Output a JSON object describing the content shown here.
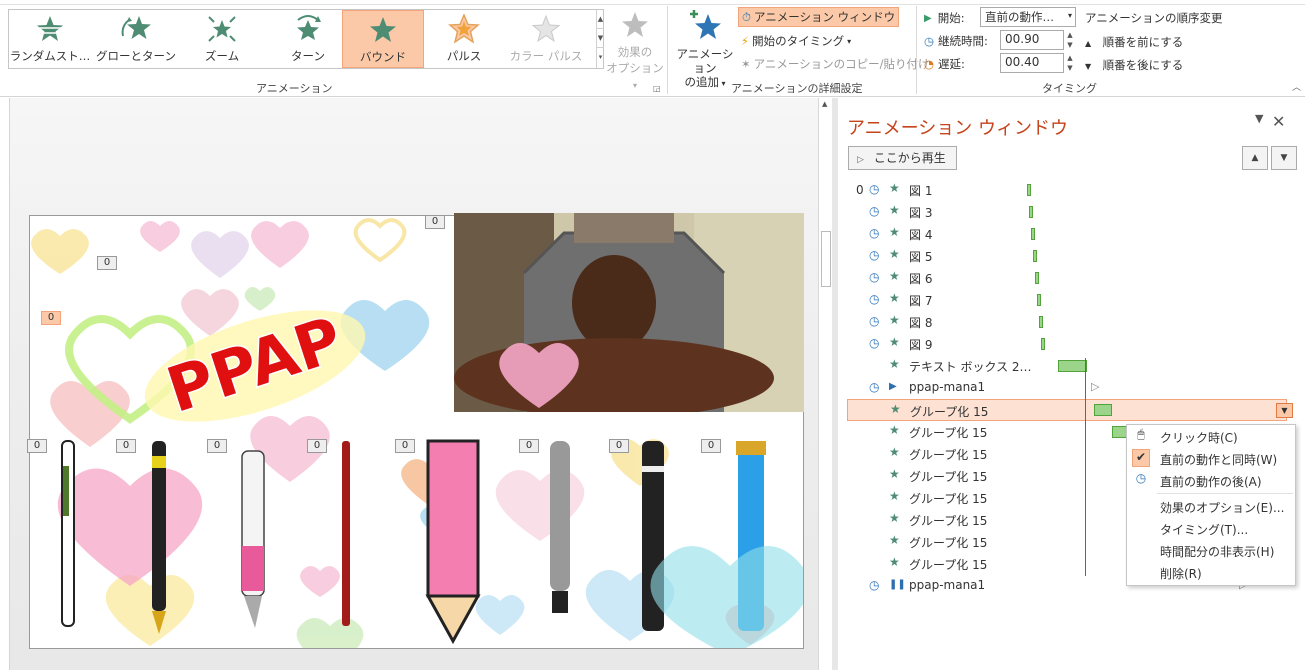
{
  "ribbon": {
    "animation_gallery": [
      {
        "label": "ランダムスト…",
        "selected": false,
        "disabled": false
      },
      {
        "label": "グローとターン",
        "selected": false,
        "disabled": false
      },
      {
        "label": "ズーム",
        "selected": false,
        "disabled": false
      },
      {
        "label": "ターン",
        "selected": false,
        "disabled": false
      },
      {
        "label": "バウンド",
        "selected": true,
        "disabled": false
      },
      {
        "label": "パルス",
        "selected": false,
        "disabled": false
      },
      {
        "label": "カラー パルス",
        "selected": false,
        "disabled": true
      }
    ],
    "effect_options_label_1": "効果の",
    "effect_options_label_2": "オプション",
    "group_animation": "アニメーション",
    "add_animation_1": "アニメーション",
    "add_animation_2": "の追加",
    "animation_pane_button": "アニメーション ウィンドウ",
    "trigger_button": "開始のタイミング",
    "animation_painter": "アニメーションのコピー/貼り付け",
    "group_advanced": "アニメーションの詳細設定",
    "start_label": "開始:",
    "start_value": "直前の動作…",
    "duration_label": "継続時間:",
    "duration_value": "00.90",
    "delay_label": "遅延:",
    "delay_value": "00.40",
    "reorder_title": "アニメーションの順序変更",
    "move_earlier": "順番を前にする",
    "move_later": "順番を後にする",
    "group_timing": "タイミング",
    "accent_color": "#fbc9a7",
    "star_color": "#4e8c74"
  },
  "slide": {
    "title_text": "PPAP",
    "badges": [
      "0",
      "0",
      "0",
      "0",
      "0",
      "0",
      "0",
      "0",
      "0",
      "0",
      "0",
      "0"
    ]
  },
  "pane": {
    "title": "アニメーション ウィンドウ",
    "play_from": "ここから再生",
    "items": [
      {
        "num": "0",
        "name": "図 1",
        "clock": true,
        "icon": "star"
      },
      {
        "num": "",
        "name": "図 3",
        "clock": true,
        "icon": "star"
      },
      {
        "num": "",
        "name": "図 4",
        "clock": true,
        "icon": "star"
      },
      {
        "num": "",
        "name": "図 5",
        "clock": true,
        "icon": "star"
      },
      {
        "num": "",
        "name": "図 6",
        "clock": true,
        "icon": "star"
      },
      {
        "num": "",
        "name": "図 7",
        "clock": true,
        "icon": "star"
      },
      {
        "num": "",
        "name": "図 8",
        "clock": true,
        "icon": "star"
      },
      {
        "num": "",
        "name": "図 9",
        "clock": true,
        "icon": "star"
      },
      {
        "num": "",
        "name": "テキスト ボックス 2…",
        "clock": false,
        "icon": "star"
      },
      {
        "num": "",
        "name": "ppap-mana1",
        "clock": true,
        "icon": "play"
      },
      {
        "num": "",
        "name": "グループ化 15",
        "clock": false,
        "icon": "star",
        "selected": true
      },
      {
        "num": "",
        "name": "グループ化 15",
        "clock": false,
        "icon": "star"
      },
      {
        "num": "",
        "name": "グループ化 15",
        "clock": false,
        "icon": "star"
      },
      {
        "num": "",
        "name": "グループ化 15",
        "clock": false,
        "icon": "star"
      },
      {
        "num": "",
        "name": "グループ化 15",
        "clock": false,
        "icon": "star"
      },
      {
        "num": "",
        "name": "グループ化 15",
        "clock": false,
        "icon": "star"
      },
      {
        "num": "",
        "name": "グループ化 15",
        "clock": false,
        "icon": "star"
      },
      {
        "num": "",
        "name": "グループ化 15",
        "clock": false,
        "icon": "star"
      },
      {
        "num": "",
        "name": "ppap-mana1",
        "clock": true,
        "icon": "pause"
      }
    ]
  },
  "context_menu": {
    "on_click": "クリック時(C)",
    "with_previous": "直前の動作と同時(W)",
    "after_previous": "直前の動作の後(A)",
    "effect_options": "効果のオプション(E)...",
    "timing": "タイミング(T)...",
    "hide_timeline": "時間配分の非表示(H)",
    "remove": "削除(R)"
  }
}
